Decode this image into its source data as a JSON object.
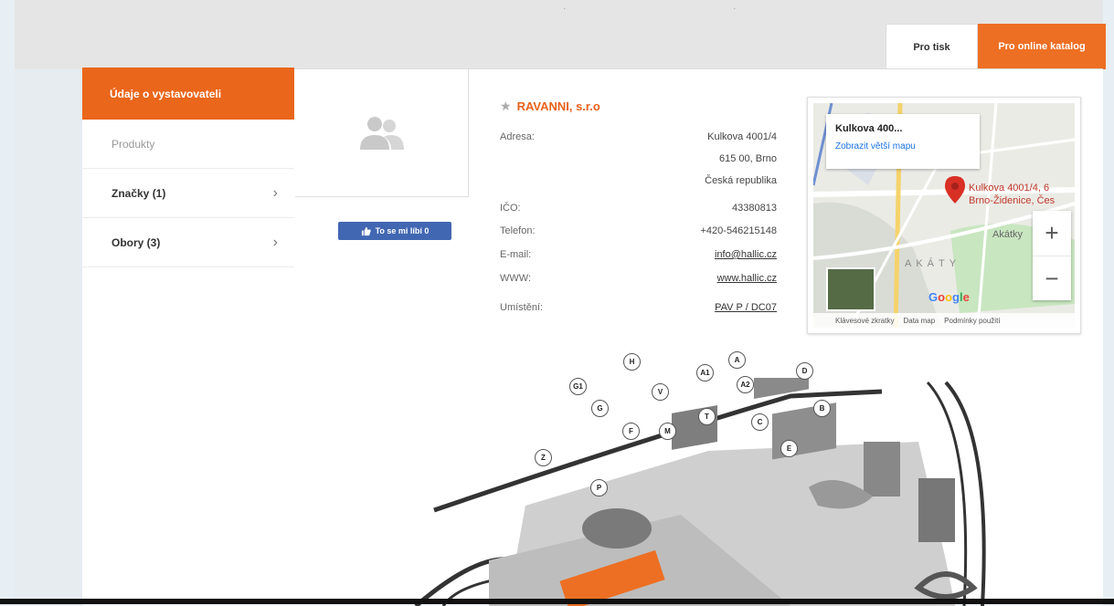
{
  "top_tabs": {
    "print_label": "Pro tisk",
    "online_label": "Pro online katalog"
  },
  "sidebar": {
    "active": "Údaje o vystavovateli",
    "items": [
      {
        "label": "Produkty",
        "chevron": false
      },
      {
        "label": "Značky (1)",
        "chevron": true
      },
      {
        "label": "Obory (3)",
        "chevron": true
      }
    ]
  },
  "like_button": {
    "label": "To se mi líbí 0",
    "icon": "thumbs-up-icon"
  },
  "company": {
    "name": "RAVANNI, s.r.o",
    "rows": [
      {
        "label": "Adresa:",
        "value": "Kulkova 4001/4"
      },
      {
        "label": "",
        "value": "615 00, Brno"
      },
      {
        "label": "",
        "value": "Česká republika"
      },
      {
        "label": "IČO:",
        "value": "43380813"
      },
      {
        "label": "Telefon:",
        "value": "+420-546215148"
      },
      {
        "label": "E-mail:",
        "value": "info@hallic.cz"
      },
      {
        "label": "WWW:",
        "value": "www.hallic.cz"
      },
      {
        "label": "Umístění:",
        "value": "PAV P / DC07"
      }
    ]
  },
  "map": {
    "bubble_title": "Kulkova 400...",
    "bubble_link": "Zobrazit větší mapu",
    "pin_label_1": "Kulkova 4001/4, 6",
    "pin_label_2": "Brno-Židenice, Čes",
    "area_label_1": "Akátky",
    "area_label_2": "AKÁTY",
    "google": "Google",
    "footer": [
      "Klávesové zkratky",
      "Data map",
      "Podmínky použití"
    ],
    "zoom_in": "+",
    "zoom_out": "−"
  },
  "venue_map_labels": [
    "Z",
    "P",
    "G1",
    "G",
    "H",
    "F",
    "V",
    "M",
    "A1",
    "A",
    "A2",
    "D",
    "B",
    "C",
    "E",
    "T"
  ],
  "colors": {
    "accent": "#ea661b",
    "facebook": "#4267b2",
    "map_pin": "#d93025"
  }
}
